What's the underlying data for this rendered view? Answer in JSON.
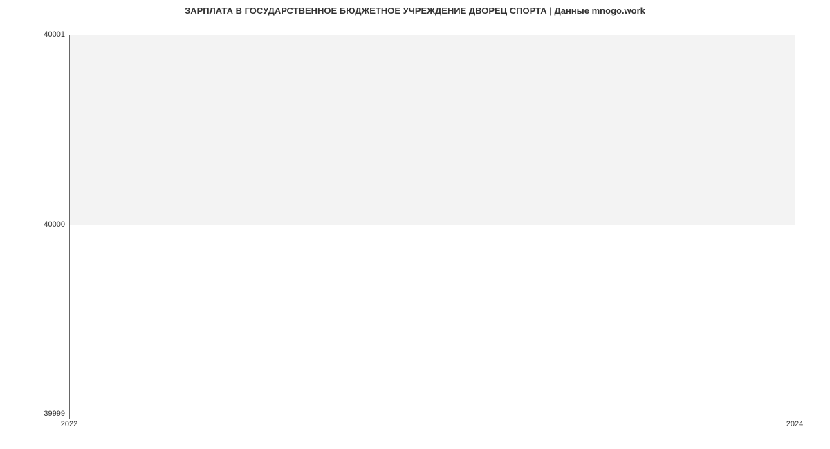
{
  "chart_data": {
    "type": "area",
    "title": "ЗАРПЛАТА В ГОСУДАРСТВЕННОЕ БЮДЖЕТНОЕ УЧРЕЖДЕНИЕ ДВОРЕЦ СПОРТА | Данные mnogo.work",
    "x": [
      2022,
      2024
    ],
    "values": [
      40000,
      40000
    ],
    "xlabel": "",
    "ylabel": "",
    "ylim": [
      39999,
      40001
    ],
    "xlim": [
      2022,
      2024
    ],
    "y_ticks": [
      39999,
      40000,
      40001
    ],
    "x_ticks": [
      2022,
      2024
    ],
    "line_color": "#4a88e0",
    "fill_color": "#f3f3f3"
  }
}
